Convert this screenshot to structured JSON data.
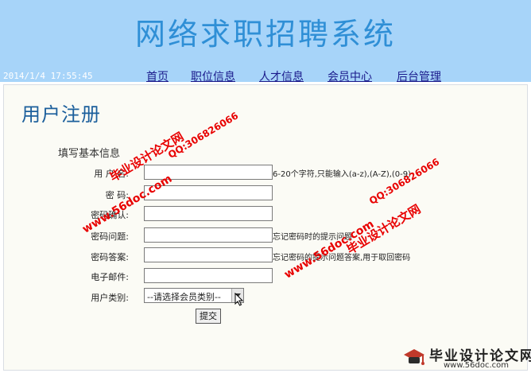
{
  "header": {
    "site_title": "网络求职招聘系统",
    "datetime": "2014/1/4 17:55:45",
    "nav": [
      "首页",
      "职位信息",
      "人才信息",
      "会员中心",
      "后台管理"
    ]
  },
  "main": {
    "page_heading": "用户注册",
    "section_heading": "填写基本信息",
    "fields": [
      {
        "label": "用 户 名:",
        "value": "",
        "hint": "6-20个字符,只能输入(a-z),(A-Z),(0-9)"
      },
      {
        "label": "密 码:",
        "value": "",
        "hint": ""
      },
      {
        "label": "密码确认:",
        "value": "",
        "hint": ""
      },
      {
        "label": "密码问题:",
        "value": "",
        "hint": "忘记密码时的提示问题"
      },
      {
        "label": "密码答案:",
        "value": "",
        "hint": "忘记密码的提示问题答案,用于取回密码"
      },
      {
        "label": "电子邮件:",
        "value": "",
        "hint": ""
      }
    ],
    "member_type": {
      "label": "用户类别:",
      "selected": "--请选择会员类别--"
    },
    "submit_label": "提交"
  },
  "watermarks": {
    "site": "毕业设计论文网",
    "domain": "www.56doc.com",
    "qq": "QQ:306826066"
  },
  "logo": {
    "text": "毕业设计论文网",
    "url": "www.56doc.com"
  },
  "colors": {
    "header_bg": "#a7d4f9",
    "title": "#2f8fd6",
    "nav_link": "#1a1a8c",
    "heading": "#1c5f9c",
    "watermark": "#e80000"
  }
}
